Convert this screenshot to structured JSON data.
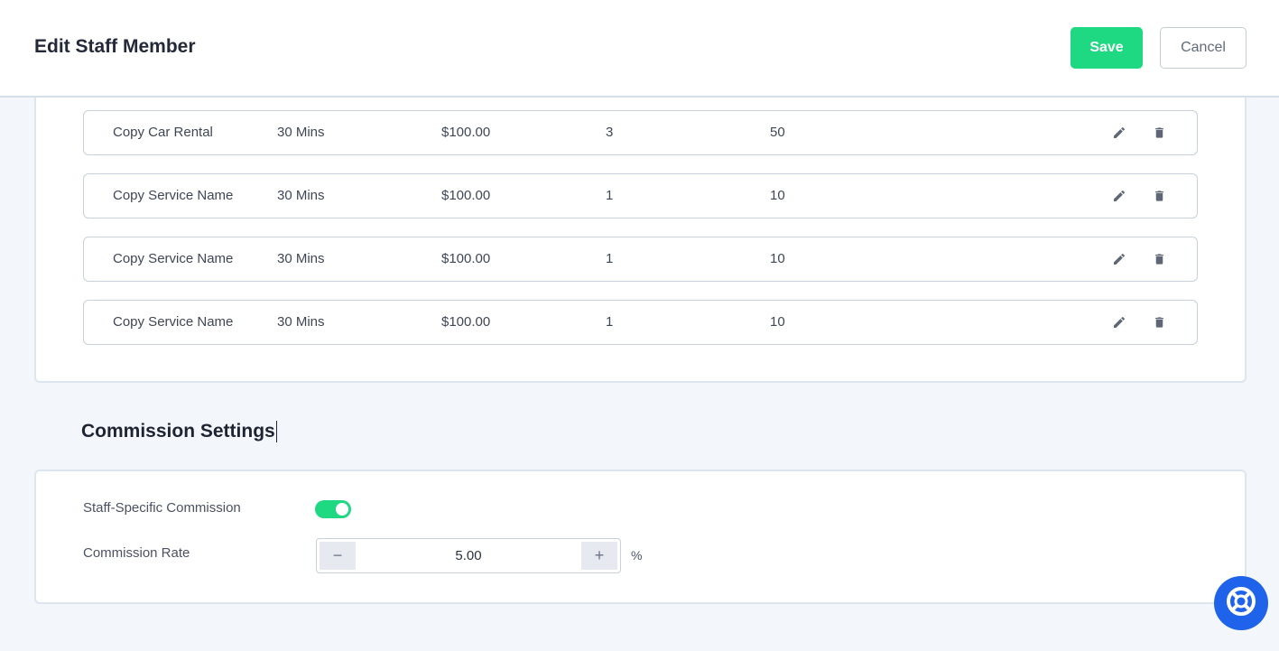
{
  "header": {
    "title": "Edit Staff Member",
    "save_label": "Save",
    "cancel_label": "Cancel"
  },
  "services": {
    "rows": [
      {
        "name": "Copy Car Rental",
        "duration": "30 Mins",
        "price": "$100.00",
        "capacity": "3",
        "min": "50"
      },
      {
        "name": "Copy Service Name",
        "duration": "30 Mins",
        "price": "$100.00",
        "capacity": "1",
        "min": "10"
      },
      {
        "name": "Copy Service Name",
        "duration": "30 Mins",
        "price": "$100.00",
        "capacity": "1",
        "min": "10"
      },
      {
        "name": "Copy Service Name",
        "duration": "30 Mins",
        "price": "$100.00",
        "capacity": "1",
        "min": "10"
      }
    ],
    "icons": {
      "edit": "pencil-icon",
      "delete": "trash-icon"
    }
  },
  "commission": {
    "title": "Commission Settings",
    "staff_specific_label": "Staff-Specific Commission",
    "staff_specific_enabled": true,
    "rate_label": "Commission Rate",
    "rate_value": "5.00",
    "rate_unit": "%",
    "minus_label": "−",
    "plus_label": "+"
  },
  "help_button": {
    "icon": "lifebuoy-icon"
  },
  "colors": {
    "accent": "#1fd882",
    "help": "#1e63e9",
    "background": "#f3f6fa"
  }
}
